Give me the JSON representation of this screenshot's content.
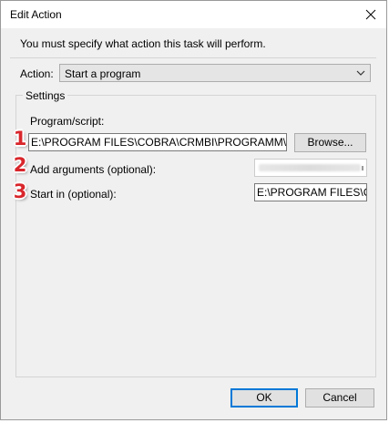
{
  "window": {
    "title": "Edit Action",
    "close_icon": "close-icon"
  },
  "intro_text": "You must specify what action this task will perform.",
  "action": {
    "label": "Action:",
    "selected": "Start a program"
  },
  "settings": {
    "legend": "Settings",
    "program_label": "Program/script:",
    "program_value": "E:\\PROGRAM FILES\\COBRA\\CRMBI\\PROGRAMM\\MODU",
    "browse_label": "Browse...",
    "arguments_label": "Add arguments (optional):",
    "start_in_label": "Start in (optional):",
    "start_in_value": "E:\\PROGRAM FILES\\COB"
  },
  "badges": [
    "1",
    "2",
    "3"
  ],
  "buttons": {
    "ok": "OK",
    "cancel": "Cancel"
  },
  "colors": {
    "accent": "#0078d7",
    "badge": "#d8262b"
  }
}
